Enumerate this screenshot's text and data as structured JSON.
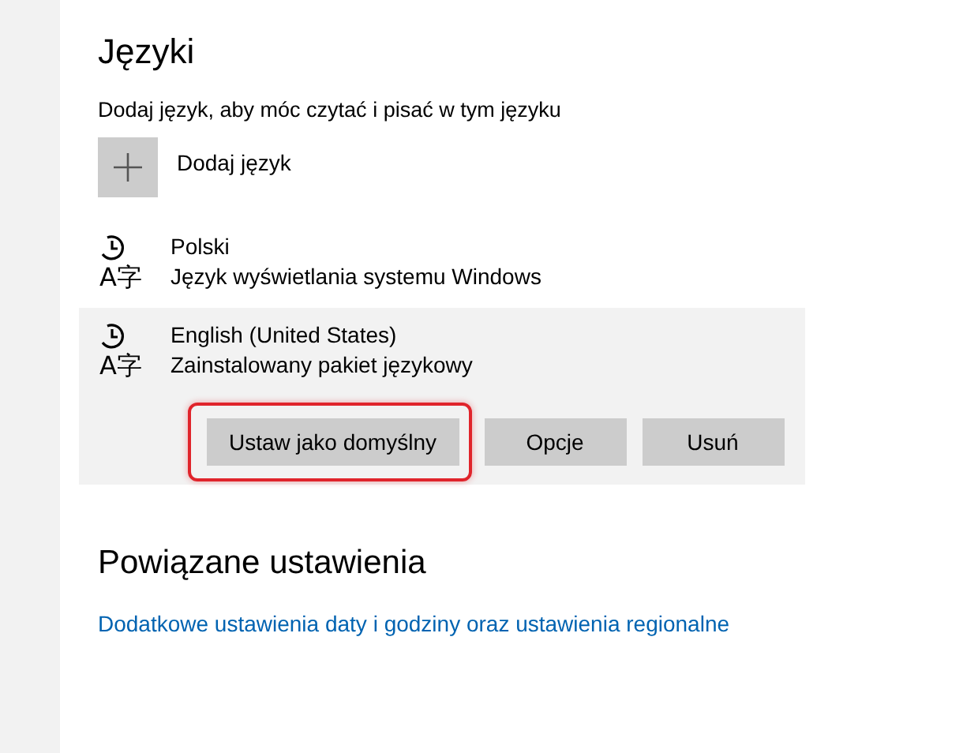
{
  "heading": "Języki",
  "description": "Dodaj język, aby móc czytać i pisać w tym języku",
  "add_language": {
    "label": "Dodaj język"
  },
  "languages": [
    {
      "icon_glyph": "A字",
      "name": "Polski",
      "status": "Język wyświetlania systemu Windows",
      "selected": false
    },
    {
      "icon_glyph": "A字",
      "name": "English (United States)",
      "status": "Zainstalowany pakiet językowy",
      "selected": true,
      "buttons": [
        {
          "label": "Ustaw jako domyślny",
          "highlighted": true
        },
        {
          "label": "Opcje",
          "highlighted": false
        },
        {
          "label": "Usuń",
          "highlighted": false
        }
      ]
    }
  ],
  "related": {
    "heading": "Powiązane ustawienia",
    "link": "Dodatkowe ustawienia daty i godziny oraz ustawienia regionalne"
  }
}
